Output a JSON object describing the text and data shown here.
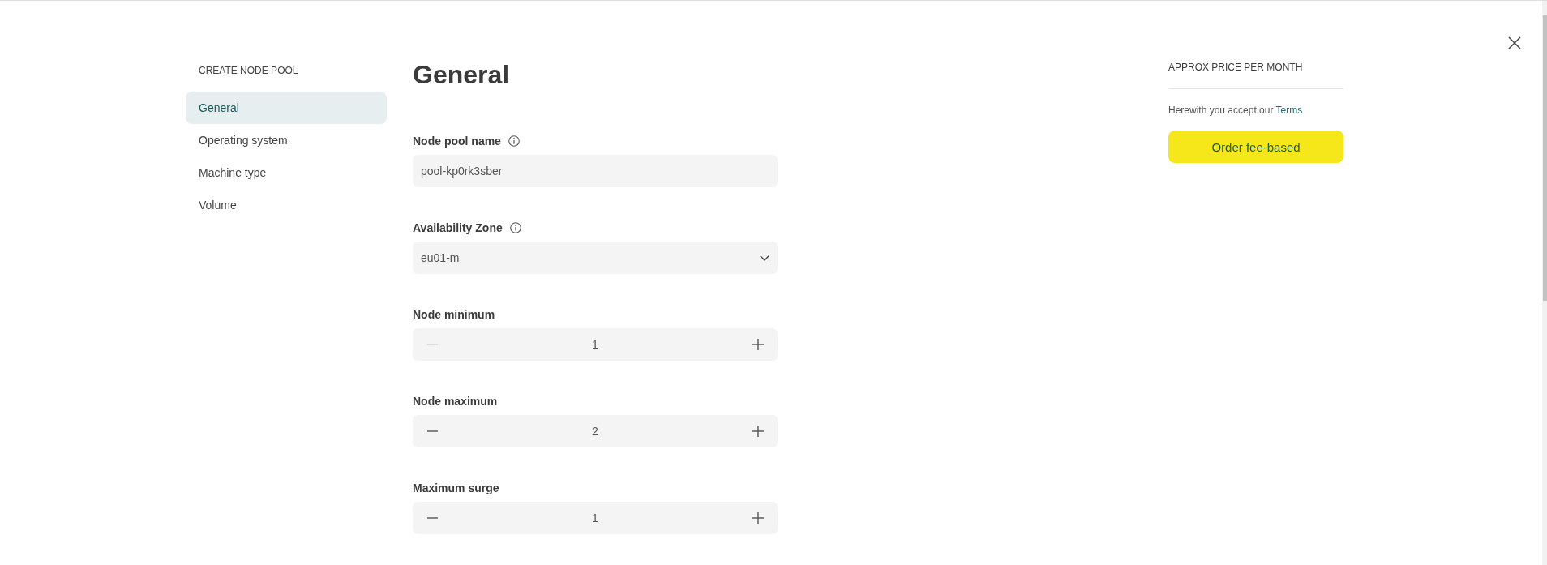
{
  "sidebar": {
    "title": "CREATE NODE POOL",
    "items": [
      {
        "label": "General",
        "selected": true
      },
      {
        "label": "Operating system",
        "selected": false
      },
      {
        "label": "Machine type",
        "selected": false
      },
      {
        "label": "Volume",
        "selected": false
      }
    ]
  },
  "main": {
    "heading": "General",
    "fields": [
      {
        "kind": "text",
        "label": "Node pool name",
        "info": true,
        "value": "pool-kp0rk3sber"
      },
      {
        "kind": "select",
        "label": "Availability Zone",
        "info": true,
        "value": "eu01-m"
      },
      {
        "kind": "stepper",
        "label": "Node minimum",
        "info": false,
        "value": "1",
        "decrement_disabled": true
      },
      {
        "kind": "stepper",
        "label": "Node maximum",
        "info": false,
        "value": "2",
        "decrement_disabled": false
      },
      {
        "kind": "stepper",
        "label": "Maximum surge",
        "info": false,
        "value": "1",
        "decrement_disabled": false
      }
    ]
  },
  "summary": {
    "title": "APPROX PRICE PER MONTH",
    "terms_text": "Herewith you accept our",
    "terms_link": "Terms",
    "order_button": "Order fee-based"
  }
}
